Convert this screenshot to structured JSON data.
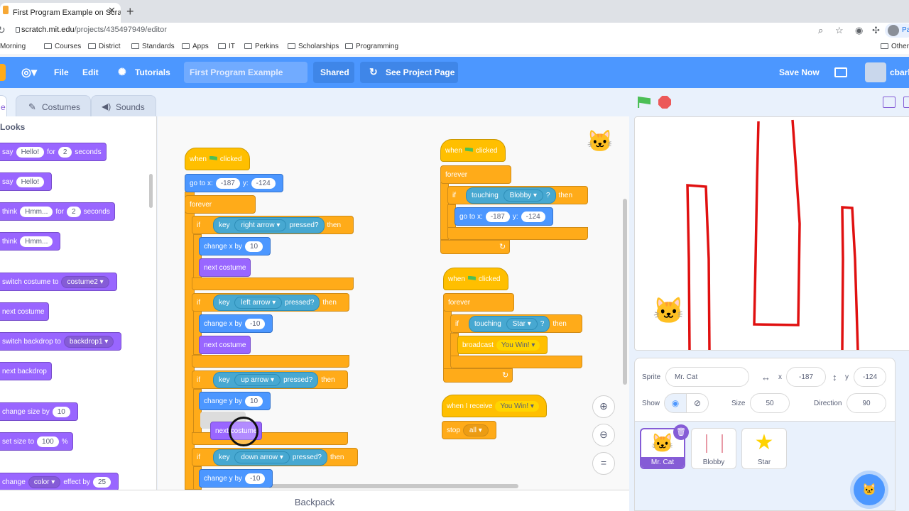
{
  "browser": {
    "tab_title": "First Program Example on Scra",
    "url_host": "scratch.mit.edu",
    "url_path": "/projects/435497949/editor",
    "profile_label": "Pa",
    "bookmarks": [
      "Morning",
      "Courses",
      "District",
      "Standards",
      "Apps",
      "IT",
      "Perkins",
      "Scholarships",
      "Programming"
    ],
    "other_bookmarks": "Other"
  },
  "menubar": {
    "file": "File",
    "edit": "Edit",
    "tutorials": "Tutorials",
    "project_title": "First Program Example",
    "shared": "Shared",
    "see_project": "See Project Page",
    "save_now": "Save Now",
    "username": "cbark"
  },
  "editor_tabs": {
    "code": "e",
    "costumes": "Costumes",
    "sounds": "Sounds"
  },
  "palette": {
    "category": "Looks",
    "say": "say",
    "hello": "Hello!",
    "for": "for",
    "two": "2",
    "seconds": "seconds",
    "think": "think",
    "hmm": "Hmm...",
    "switch_costume": "switch costume to",
    "costume2": "costume2",
    "next_costume": "next costume",
    "switch_backdrop": "switch backdrop to",
    "backdrop1": "backdrop1",
    "next_backdrop": "next backdrop",
    "change_size": "change size by",
    "size_ten": "10",
    "set_size": "set size to",
    "size_hundred": "100",
    "percent": "%",
    "change": "change",
    "color": "color",
    "effect_by": "effect by",
    "twentyfive": "25"
  },
  "script1": {
    "when": "when",
    "clicked": "clicked",
    "goto": "go to x:",
    "x": "-187",
    "y_label": "y:",
    "y": "-124",
    "forever": "forever",
    "if": "if",
    "key": "key",
    "pressed": "pressed?",
    "then": "then",
    "right_arrow": "right arrow",
    "left_arrow": "left arrow",
    "up_arrow": "up arrow",
    "down_arrow": "down arrow",
    "change_x": "change x by",
    "change_y": "change y by",
    "ten": "10",
    "neg_ten": "-10",
    "next_costume": "next costume",
    "dragged_block": "next costume"
  },
  "script2": {
    "when": "when",
    "clicked": "clicked",
    "forever": "forever",
    "if": "if",
    "touching": "touching",
    "target": "Blobby",
    "q": "?",
    "then": "then",
    "goto": "go to x:",
    "x": "-187",
    "y_label": "y:",
    "y": "-124"
  },
  "script3": {
    "when": "when",
    "clicked": "clicked",
    "forever": "forever",
    "if": "if",
    "touching": "touching",
    "target": "Star",
    "q": "?",
    "then": "then",
    "broadcast": "broadcast",
    "message": "You Win!"
  },
  "script4": {
    "when_receive": "when I receive",
    "message": "You Win!",
    "stop": "stop",
    "all": "all"
  },
  "backpack": "Backpack",
  "sprite_info": {
    "sprite_label": "Sprite",
    "sprite_name": "Mr. Cat",
    "x_label": "x",
    "x": "-187",
    "y_label": "y",
    "y": "-124",
    "show_label": "Show",
    "size_label": "Size",
    "size": "50",
    "direction_label": "Direction",
    "direction": "90"
  },
  "sprites": [
    "Mr. Cat",
    "Blobby",
    "Star"
  ],
  "colors": {
    "scratch_blue": "#4c97ff",
    "looks": "#9966ff",
    "control": "#ffab19",
    "events": "#ffbf00",
    "sensing": "#5cb1d6",
    "motion": "#4c97ff",
    "maze_line": "#e01010"
  }
}
